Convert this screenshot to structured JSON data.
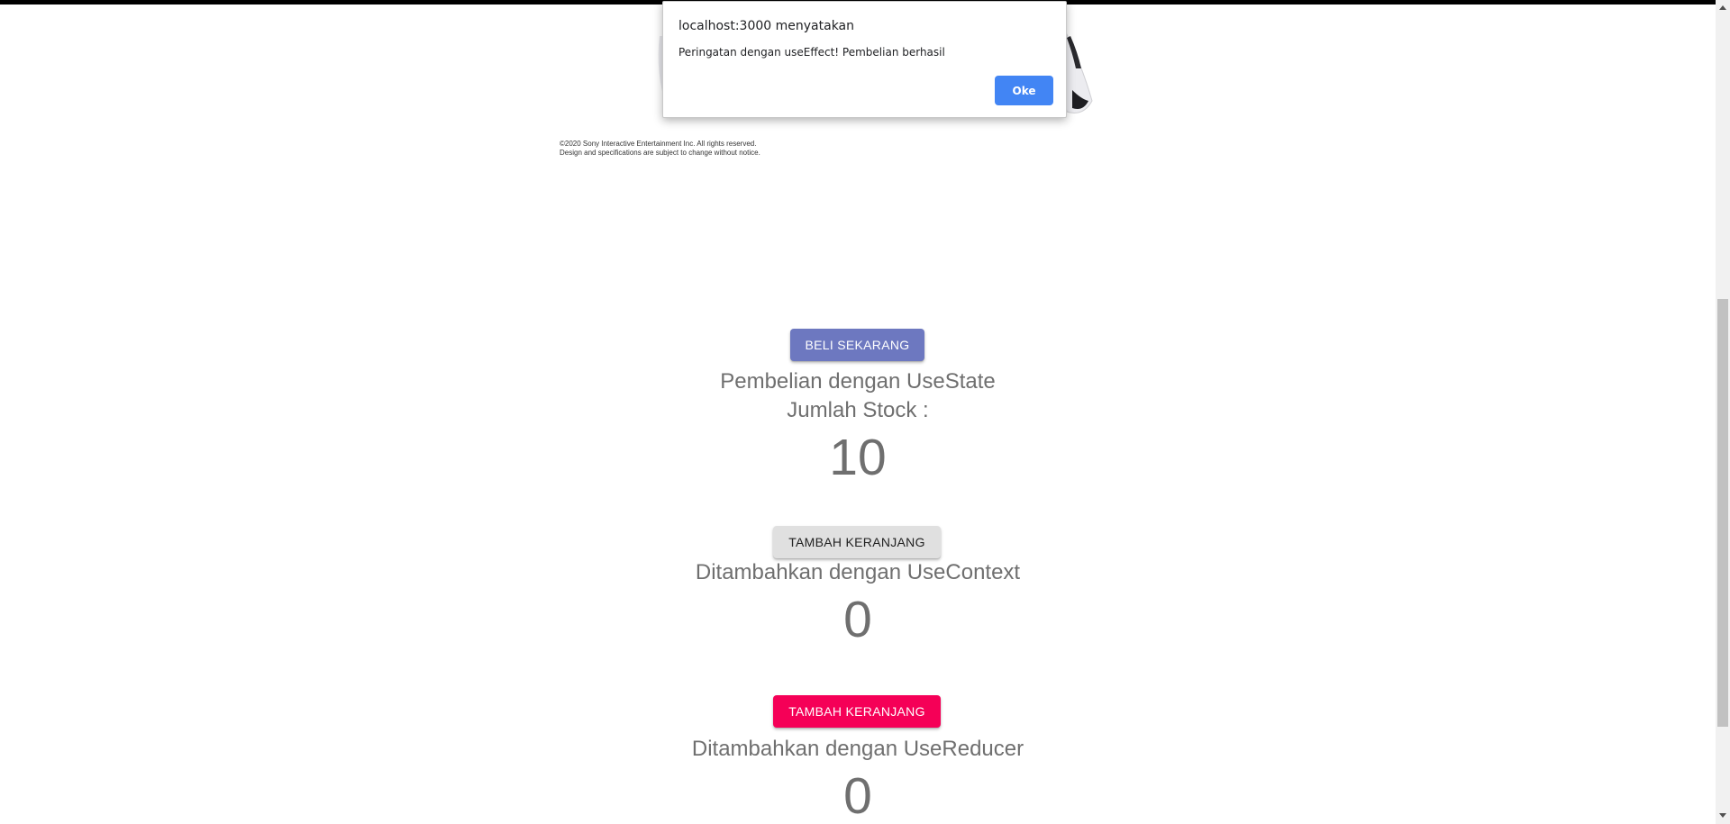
{
  "product": {
    "copyright_line1": "©2020 Sony Interactive Entertainment Inc. All rights reserved.",
    "copyright_line2": "Design and specifications are subject to change without notice."
  },
  "usestate": {
    "button_label": "BELI SEKARANG",
    "title": "Pembelian dengan UseState",
    "stock_label": "Jumlah Stock :",
    "stock_value": "10"
  },
  "usecontext": {
    "button_label": "TAMBAH KERANJANG",
    "title": "Ditambahkan dengan UseContext",
    "value": "0"
  },
  "usereducer": {
    "button_label": "TAMBAH KERANJANG",
    "title": "Ditambahkan dengan UseReducer",
    "value": "0"
  },
  "dialog": {
    "title": "localhost:3000 menyatakan",
    "message": "Peringatan dengan useEffect! Pembelian berhasil",
    "ok_label": "Oke"
  },
  "colors": {
    "primary_button": "#6d78c0",
    "default_button": "#e0e0e0",
    "secondary_button": "#f50057",
    "dialog_ok": "#4285f4",
    "text_gray": "#6f6f6f"
  }
}
